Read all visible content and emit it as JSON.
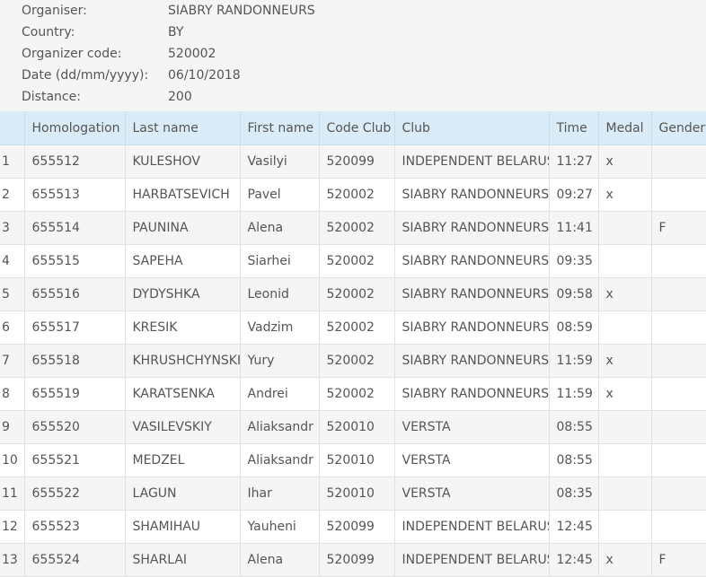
{
  "info": [
    {
      "label": "Organiser:",
      "value": "SIABRY RANDONNEURS"
    },
    {
      "label": "Country:",
      "value": "BY"
    },
    {
      "label": "Organizer code:",
      "value": "520002"
    },
    {
      "label": "Date (dd/mm/yyyy):",
      "value": "06/10/2018"
    },
    {
      "label": "Distance:",
      "value": "200"
    }
  ],
  "table": {
    "headers": [
      "",
      "Homologation",
      "Last name",
      "First name",
      "Code Club",
      "Club",
      "Time",
      "Medal",
      "Gender"
    ],
    "rows": [
      [
        "1",
        "655512",
        "KULESHOV",
        "Vasilyi",
        "520099",
        "INDEPENDENT BELARUS",
        "11:27",
        "x",
        ""
      ],
      [
        "2",
        "655513",
        "HARBATSEVICH",
        "Pavel",
        "520002",
        "SIABRY RANDONNEURS",
        "09:27",
        "x",
        ""
      ],
      [
        "3",
        "655514",
        "PAUNINA",
        "Alena",
        "520002",
        "SIABRY RANDONNEURS",
        "11:41",
        "",
        "F"
      ],
      [
        "4",
        "655515",
        "SAPEHA",
        "Siarhei",
        "520002",
        "SIABRY RANDONNEURS",
        "09:35",
        "",
        ""
      ],
      [
        "5",
        "655516",
        "DYDYSHKA",
        "Leonid",
        "520002",
        "SIABRY RANDONNEURS",
        "09:58",
        "x",
        ""
      ],
      [
        "6",
        "655517",
        "KRESIK",
        "Vadzim",
        "520002",
        "SIABRY RANDONNEURS",
        "08:59",
        "",
        ""
      ],
      [
        "7",
        "655518",
        "KHRUSHCHYNSKI",
        "Yury",
        "520002",
        "SIABRY RANDONNEURS",
        "11:59",
        "x",
        ""
      ],
      [
        "8",
        "655519",
        "KARATSENKA",
        "Andrei",
        "520002",
        "SIABRY RANDONNEURS",
        "11:59",
        "x",
        ""
      ],
      [
        "9",
        "655520",
        "VASILEVSKIY",
        "Aliaksandr",
        "520010",
        "VERSTA",
        "08:55",
        "",
        ""
      ],
      [
        "10",
        "655521",
        "MEDZEL",
        "Aliaksandr",
        "520010",
        "VERSTA",
        "08:55",
        "",
        ""
      ],
      [
        "11",
        "655522",
        "LAGUN",
        "Ihar",
        "520010",
        "VERSTA",
        "08:35",
        "",
        ""
      ],
      [
        "12",
        "655523",
        "SHAMIHAU",
        "Yauheni",
        "520099",
        "INDEPENDENT BELARUS",
        "12:45",
        "",
        ""
      ],
      [
        "13",
        "655524",
        "SHARLAI",
        "Alena",
        "520099",
        "INDEPENDENT BELARUS",
        "12:45",
        "x",
        "F"
      ]
    ]
  }
}
